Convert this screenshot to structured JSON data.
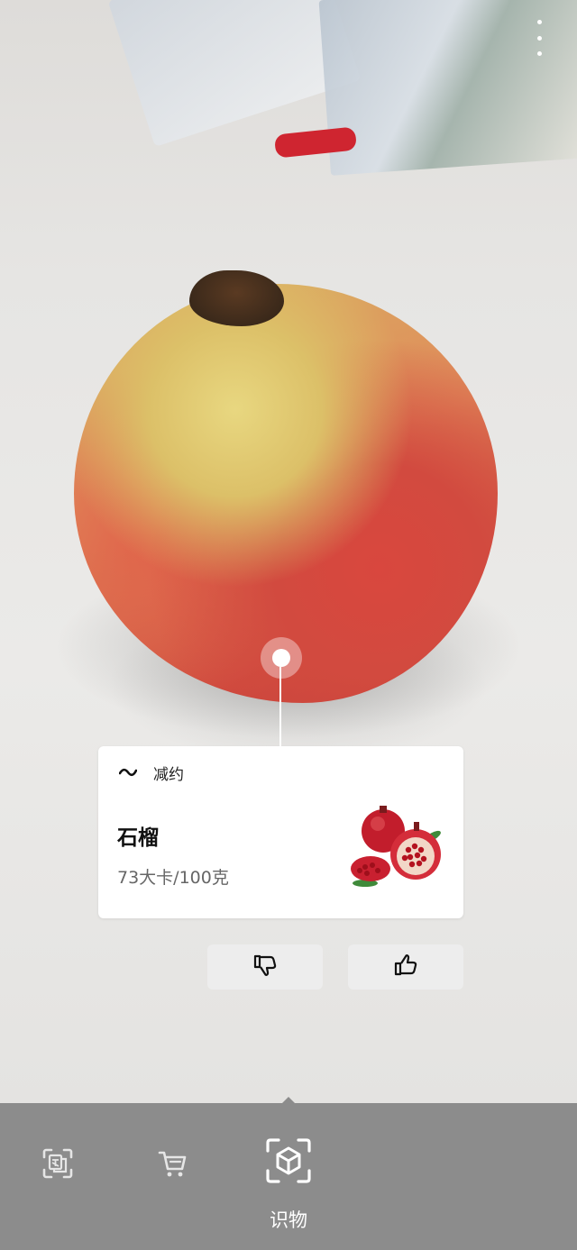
{
  "card": {
    "provider_name": "减约",
    "food_name": "石榴",
    "calories": "73大卡/100克"
  },
  "modes": {
    "active_label": "识物",
    "items": [
      "translate-scan-icon",
      "shopping-cart-icon",
      "object-recognition-icon"
    ]
  },
  "colors": {
    "accent_red": "#cf2530",
    "bottom_bar": "#8c8c8c",
    "card_bg": "#ffffff"
  }
}
